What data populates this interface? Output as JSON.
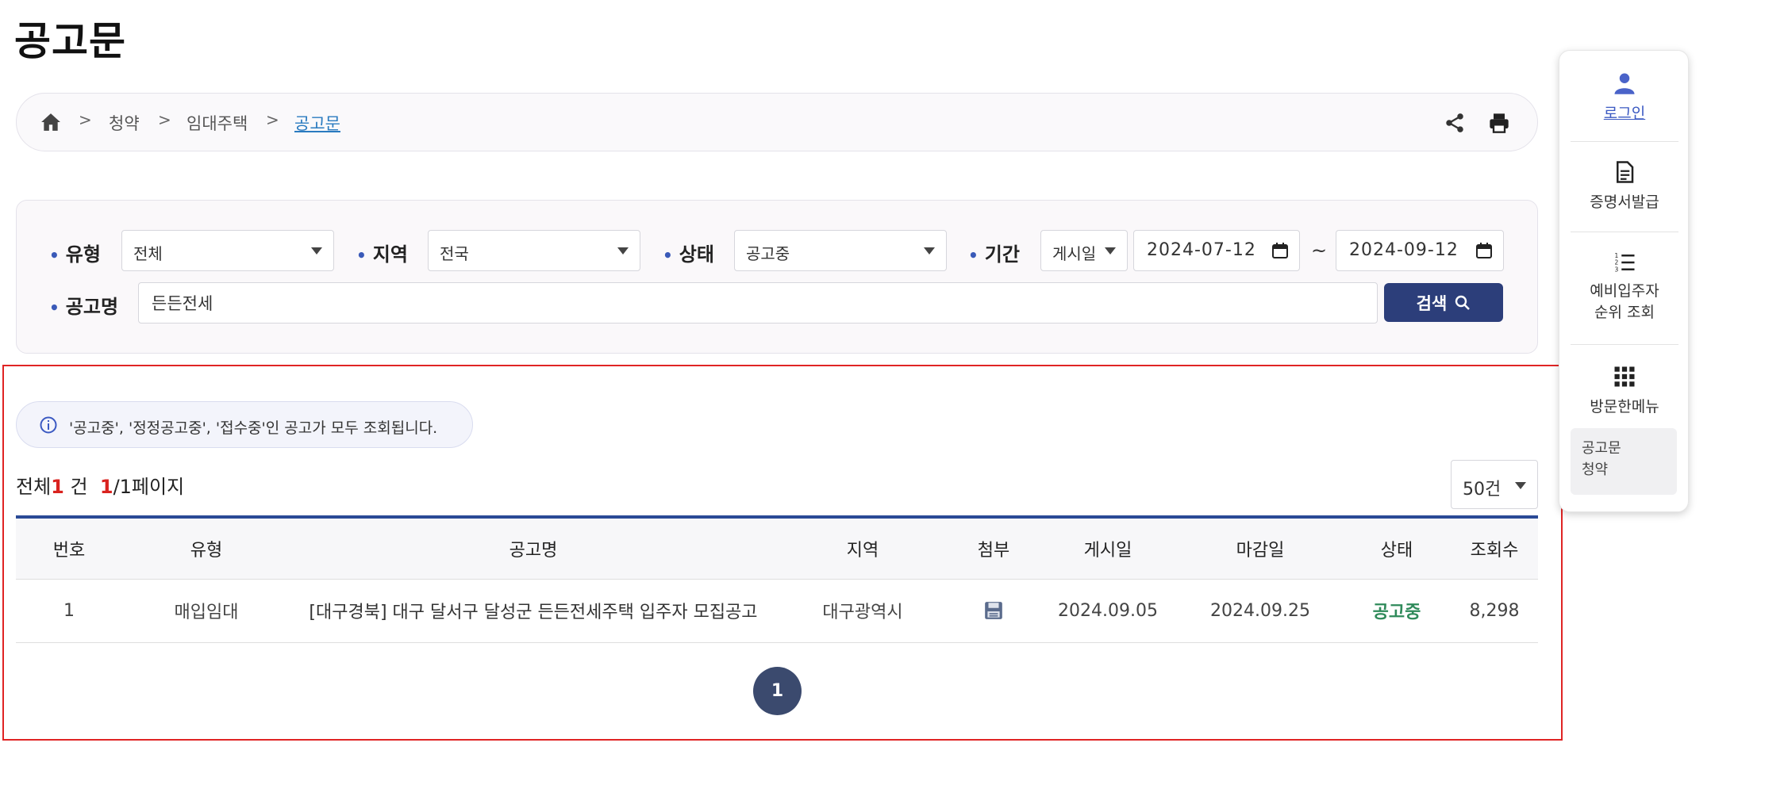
{
  "page": {
    "title": "공고문"
  },
  "breadcrumb": {
    "items": [
      "청약",
      "임대주택"
    ],
    "current": "공고문",
    "home_icon": "home-icon",
    "share_icon": "share-icon",
    "print_icon": "print-icon"
  },
  "search": {
    "type_label": "유형",
    "type_value": "전체",
    "region_label": "지역",
    "region_value": "전국",
    "status_label": "상태",
    "status_value": "공고중",
    "period_label": "기간",
    "period_type": "게시일",
    "date_from": "2024-07-12",
    "date_to": "2024-09-12",
    "tilde": "~",
    "name_label": "공고명",
    "name_value": "든든전세",
    "button_label": "검색"
  },
  "notice": {
    "text": "'공고중', '정정공고중', '접수중'인 공고가 모두 조회됩니다."
  },
  "summary": {
    "prefix": "전체",
    "total": "1",
    "unit": "건",
    "current_page": "1",
    "pages_suffix": "/1페이지"
  },
  "per_page": {
    "value": "50건"
  },
  "table": {
    "headers": [
      "번호",
      "유형",
      "공고명",
      "지역",
      "첨부",
      "게시일",
      "마감일",
      "상태",
      "조회수"
    ],
    "rows": [
      {
        "no": "1",
        "type": "매입임대",
        "title": "[대구경북] 대구 달서구 달성군 든든전세주택 입주자 모집공고",
        "region": "대구광역시",
        "attachment_icon": "floppy-disk-icon",
        "posted": "2024.09.05",
        "deadline": "2024.09.25",
        "status": "공고중",
        "views": "8,298"
      }
    ]
  },
  "pagination": {
    "current": "1"
  },
  "quick_panel": {
    "login": "로그인",
    "certificate": "증명서발급",
    "waitlist_line1": "예비입주자",
    "waitlist_line2": "순위 조회",
    "visited_menu": "방문한메뉴",
    "recent_1": "공고문",
    "recent_2": "청약"
  },
  "colors": {
    "accent": "#2c3e7a",
    "status_active": "#2f8a5a",
    "highlight_border": "#e02424",
    "count_red": "#d9231f"
  }
}
